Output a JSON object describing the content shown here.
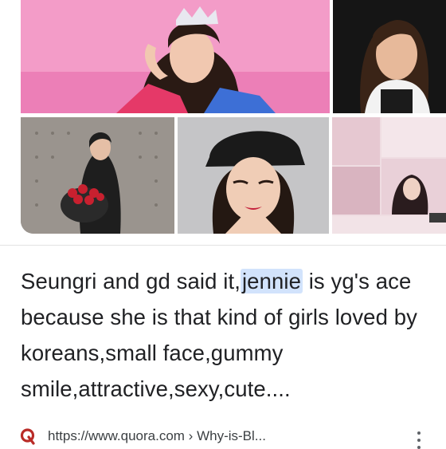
{
  "images": [
    {
      "label": "woman-with-tiara-pink-background"
    },
    {
      "label": "young-woman-dark-background"
    },
    {
      "label": "woman-holding-red-roses"
    },
    {
      "label": "woman-with-hat-closeup"
    },
    {
      "label": "pink-aesthetic-collage"
    }
  ],
  "snippet": {
    "before": "Seungri and gd said it,",
    "highlight": "jennie",
    "after": " is yg's ace because she is that kind of girls loved by koreans,small face,gummy smile,attractive,sexy,cute...."
  },
  "source": {
    "icon": "quora-icon",
    "url": "https://www.quora.com › Why-is-Bl..."
  },
  "colors": {
    "highlight": "#d2e3fc",
    "quora_red": "#b92b27",
    "text": "#202124"
  }
}
